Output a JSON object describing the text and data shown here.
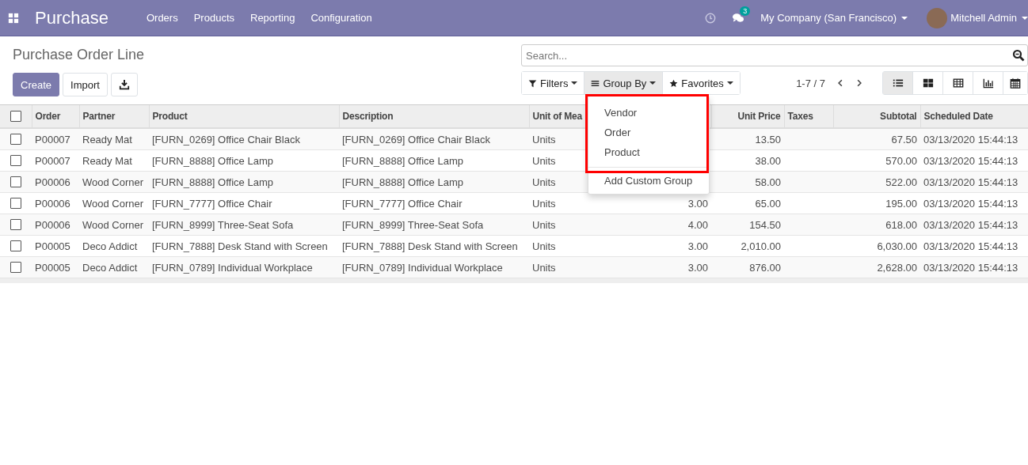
{
  "navbar": {
    "app_title": "Purchase",
    "menu": [
      "Orders",
      "Products",
      "Reporting",
      "Configuration"
    ],
    "message_count": "3",
    "company": "My Company (San Francisco)",
    "user": "Mitchell Admin"
  },
  "control_panel": {
    "title": "Purchase Order Line",
    "buttons": [
      {
        "kind": "primary",
        "label": "Create"
      },
      {
        "kind": "secondary",
        "label": "Import"
      },
      {
        "kind": "download"
      }
    ],
    "search": {
      "placeholder": "Search..."
    },
    "search_options": [
      {
        "kind": "filter",
        "label": "Filters",
        "open": false
      },
      {
        "kind": "group",
        "label": "Group By",
        "open": true
      },
      {
        "kind": "favorite",
        "label": "Favorites",
        "open": false
      }
    ],
    "pager": "1-7 / 7",
    "views": [
      {
        "kind": "list",
        "selected": true
      },
      {
        "kind": "kanban",
        "selected": false
      },
      {
        "kind": "pivot",
        "selected": false
      },
      {
        "kind": "graph",
        "selected": false
      },
      {
        "kind": "calendar",
        "selected": false
      }
    ]
  },
  "group_by_menu": {
    "items": [
      "Vendor",
      "Order",
      "Product"
    ],
    "custom": "Add Custom Group",
    "highlighted": true
  },
  "table": {
    "all_checked": false,
    "columns": [
      {
        "label": "Order",
        "kind": "text"
      },
      {
        "label": "Partner",
        "kind": "text"
      },
      {
        "label": "Product",
        "kind": "text"
      },
      {
        "label": "Description",
        "kind": "text"
      },
      {
        "label": "Unit of Mea",
        "kind": "text"
      },
      {
        "kind": "number"
      },
      {
        "label": "Unit Price",
        "kind": "number"
      },
      {
        "label": "Taxes",
        "kind": "text"
      },
      {
        "label": "Subtotal",
        "kind": "number"
      },
      {
        "label": "Scheduled Date",
        "kind": "text"
      }
    ],
    "rows": [
      {
        "checked": false,
        "cells": [
          "P00007",
          "Ready Mat",
          "[FURN_0269] Office Chair Black",
          "[FURN_0269] Office Chair Black",
          "Units",
          null,
          "13.50",
          null,
          "67.50",
          "03/13/2020 15:44:13"
        ]
      },
      {
        "checked": false,
        "cells": [
          "P00007",
          "Ready Mat",
          "[FURN_8888] Office Lamp",
          "[FURN_8888] Office Lamp",
          "Units",
          null,
          "38.00",
          null,
          "570.00",
          "03/13/2020 15:44:13"
        ]
      },
      {
        "checked": false,
        "cells": [
          "P00006",
          "Wood Corner",
          "[FURN_8888] Office Lamp",
          "[FURN_8888] Office Lamp",
          "Units",
          null,
          "58.00",
          null,
          "522.00",
          "03/13/2020 15:44:13"
        ]
      },
      {
        "checked": false,
        "cells": [
          "P00006",
          "Wood Corner",
          "[FURN_7777] Office Chair",
          "[FURN_7777] Office Chair",
          "Units",
          "3.00",
          "65.00",
          null,
          "195.00",
          "03/13/2020 15:44:13"
        ]
      },
      {
        "checked": false,
        "cells": [
          "P00006",
          "Wood Corner",
          "[FURN_8999] Three-Seat Sofa",
          "[FURN_8999] Three-Seat Sofa",
          "Units",
          "4.00",
          "154.50",
          null,
          "618.00",
          "03/13/2020 15:44:13"
        ]
      },
      {
        "checked": false,
        "cells": [
          "P00005",
          "Deco Addict",
          "[FURN_7888] Desk Stand with Screen",
          "[FURN_7888] Desk Stand with Screen",
          "Units",
          "3.00",
          "2,010.00",
          null,
          "6,030.00",
          "03/13/2020 15:44:13"
        ]
      },
      {
        "checked": false,
        "cells": [
          "P00005",
          "Deco Addict",
          "[FURN_0789] Individual Workplace",
          "[FURN_0789] Individual Workplace",
          "Units",
          "3.00",
          "876.00",
          null,
          "2,628.00",
          "03/13/2020 15:44:13"
        ]
      }
    ]
  }
}
